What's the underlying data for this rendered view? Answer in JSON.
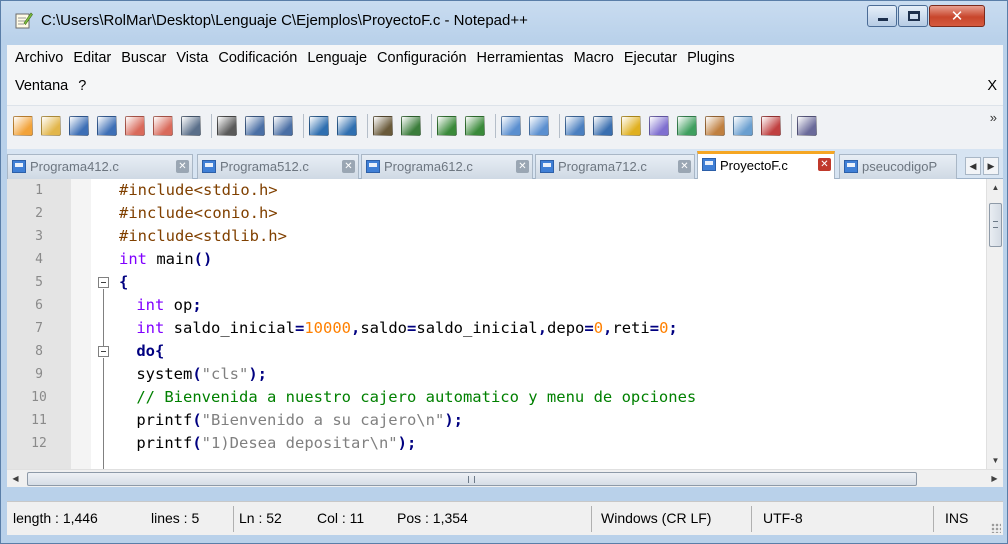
{
  "window": {
    "title": "C:\\Users\\RolMar\\Desktop\\Lenguaje C\\Ejemplos\\ProyectoF.c - Notepad++"
  },
  "menu": {
    "row1": [
      "Archivo",
      "Editar",
      "Buscar",
      "Vista",
      "Codificación",
      "Lenguaje",
      "Configuración",
      "Herramientas",
      "Macro",
      "Ejecutar",
      "Plugins"
    ],
    "row2": [
      "Ventana",
      "?"
    ],
    "close_doc": "X"
  },
  "tabs": [
    {
      "label": "Programa412.c",
      "active": false
    },
    {
      "label": "Programa512.c",
      "active": false
    },
    {
      "label": "Programa612.c",
      "active": false
    },
    {
      "label": "Programa712.c",
      "active": false
    },
    {
      "label": "ProyectoF.c",
      "active": true
    },
    {
      "label": "pseucodigoP",
      "active": false
    }
  ],
  "editor": {
    "line_numbers": [
      "1",
      "2",
      "3",
      "4",
      "5",
      "6",
      "7",
      "8",
      "9",
      "10",
      "11",
      "12"
    ],
    "lines": [
      [
        {
          "t": "#include<stdio.h>",
          "c": "pp"
        }
      ],
      [
        {
          "t": "#include<conio.h>",
          "c": "pp"
        }
      ],
      [
        {
          "t": "#include<stdlib.h>",
          "c": "pp"
        }
      ],
      [
        {
          "t": "int",
          "c": "kw"
        },
        {
          "t": " main",
          "c": "id"
        },
        {
          "t": "()",
          "c": "op"
        }
      ],
      [
        {
          "t": "{",
          "c": "op"
        }
      ],
      [
        {
          "t": " int",
          "c": "kw"
        },
        {
          "t": " op",
          "c": "id"
        },
        {
          "t": ";",
          "c": "op"
        }
      ],
      [
        {
          "t": " int",
          "c": "kw"
        },
        {
          "t": " saldo_inicial",
          "c": "id"
        },
        {
          "t": "=",
          "c": "op"
        },
        {
          "t": "10000",
          "c": "num"
        },
        {
          "t": ",",
          "c": "op"
        },
        {
          "t": "saldo",
          "c": "id"
        },
        {
          "t": "=",
          "c": "op"
        },
        {
          "t": "saldo_inicial",
          "c": "id"
        },
        {
          "t": ",",
          "c": "op"
        },
        {
          "t": "depo",
          "c": "id"
        },
        {
          "t": "=",
          "c": "op"
        },
        {
          "t": "0",
          "c": "num"
        },
        {
          "t": ",",
          "c": "op"
        },
        {
          "t": "reti",
          "c": "id"
        },
        {
          "t": "=",
          "c": "op"
        },
        {
          "t": "0",
          "c": "num"
        },
        {
          "t": ";",
          "c": "op"
        }
      ],
      [
        {
          "t": " do",
          "c": "op"
        },
        {
          "t": "{",
          "c": "op"
        }
      ],
      [
        {
          "t": " system",
          "c": "id"
        },
        {
          "t": "(",
          "c": "op"
        },
        {
          "t": "\"cls\"",
          "c": "str"
        },
        {
          "t": ");",
          "c": "op"
        }
      ],
      [
        {
          "t": " // Bienvenida a nuestro cajero automatico y menu de opciones",
          "c": "cm"
        }
      ],
      [
        {
          "t": " printf",
          "c": "id"
        },
        {
          "t": "(",
          "c": "op"
        },
        {
          "t": "\"Bienvenido a su cajero\\n\"",
          "c": "str"
        },
        {
          "t": ");",
          "c": "op"
        }
      ],
      [
        {
          "t": " printf",
          "c": "id"
        },
        {
          "t": "(",
          "c": "op"
        },
        {
          "t": "\"1)Desea depositar\\n\"",
          "c": "str"
        },
        {
          "t": ");",
          "c": "op"
        }
      ]
    ]
  },
  "status": {
    "length": "length : 1,446",
    "lines": "lines : 5",
    "ln": "Ln : 52",
    "col": "Col : 11",
    "pos": "Pos : 1,354",
    "eol": "Windows (CR LF)",
    "encoding": "UTF-8",
    "mode": "INS"
  },
  "colors": {
    "preprocessor": "#804000",
    "keyword": "#8000ff",
    "operator": "#000080",
    "number": "#ff8000",
    "string": "#808080",
    "comment": "#008000",
    "active_tab_accent": "#f5a623"
  },
  "icons": {
    "titlebar": [
      "notepadpp-icon",
      "minimize-icon",
      "maximize-icon",
      "close-icon"
    ],
    "toolbar": [
      "new-file-icon",
      "open-file-icon",
      "save-icon",
      "save-all-icon",
      "close-file-icon",
      "close-all-icon",
      "print-icon",
      "cut-icon",
      "copy-icon",
      "paste-icon",
      "undo-icon",
      "redo-icon",
      "find-icon",
      "replace-icon",
      "zoom-in-icon",
      "zoom-out-icon",
      "sync-vertical-icon",
      "sync-horizontal-icon",
      "word-wrap-icon",
      "show-all-chars-icon",
      "indent-guide-icon",
      "language-icon",
      "function-list-icon",
      "folder-workspace-icon",
      "document-map-icon",
      "record-macro-icon",
      "preview-icon"
    ]
  }
}
